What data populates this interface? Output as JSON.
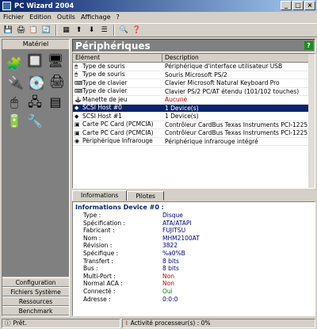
{
  "window": {
    "title": "PC Wizard 2004"
  },
  "menu": [
    "Fichier",
    "Edition",
    "Outils",
    "Affichage",
    "?"
  ],
  "left": {
    "header": "Matériel",
    "tabs": [
      "Configuration",
      "Fichiers Système",
      "Ressources",
      "Benchmark"
    ]
  },
  "right": {
    "header": "Périphériques",
    "columns": [
      "Elément",
      "Description"
    ],
    "rows": [
      {
        "name": "Type de souris",
        "desc": "Périphérique d'interface utilisateur USB"
      },
      {
        "name": "Type de souris",
        "desc": "Souris Microsoft PS/2"
      },
      {
        "name": "Type de clavier",
        "desc": "Clavier Microsoft Natural Keyboard Pro"
      },
      {
        "name": "Type de clavier",
        "desc": "Clavier PS/2 PC/AT étendu (101/102 touches)"
      },
      {
        "name": "Manette de jeu",
        "desc": "Aucune"
      },
      {
        "name": "SCSI Host #0",
        "desc": "1 Device(s)"
      },
      {
        "name": "SCSI Host #1",
        "desc": "1 Device(s)"
      },
      {
        "name": "Carte PC Card (PCMCIA)",
        "desc": "Contrôleur CardBus Texas Instruments PCI-1225"
      },
      {
        "name": "Carte PC Card (PCMCIA)",
        "desc": "Contrôleur CardBus Texas Instruments PCI-1225"
      },
      {
        "name": "Périphérique Infrarouge",
        "desc": "Périphérique infrarouge intégré"
      }
    ],
    "tabs": [
      "Informations",
      "Pilotes"
    ],
    "details_title": "Informations Device #0 :",
    "details": [
      {
        "k": "Type :",
        "v": "Disque"
      },
      {
        "k": "Spécification :",
        "v": "ATA/ATAPI"
      },
      {
        "k": "Fabricant :",
        "v": "FUJITSU"
      },
      {
        "k": "Nom :",
        "v": "MHM2100AT"
      },
      {
        "k": "Révision :",
        "v": "3822"
      },
      {
        "k": "Spécifique :",
        "v": "%a0%B"
      },
      {
        "k": "Transfert :",
        "v": "8 bits"
      },
      {
        "k": "Bus :",
        "v": "8 bits"
      },
      {
        "k": "Multi-Port :",
        "v": "Non"
      },
      {
        "k": "Normal ACA :",
        "v": "Non"
      },
      {
        "k": "Connecté :",
        "v": "Oui"
      },
      {
        "k": "Adresse :",
        "v": "0:0:0"
      }
    ]
  },
  "status": {
    "ready": "Prêt.",
    "cpu": "Activité processeur(s) : 0%"
  }
}
